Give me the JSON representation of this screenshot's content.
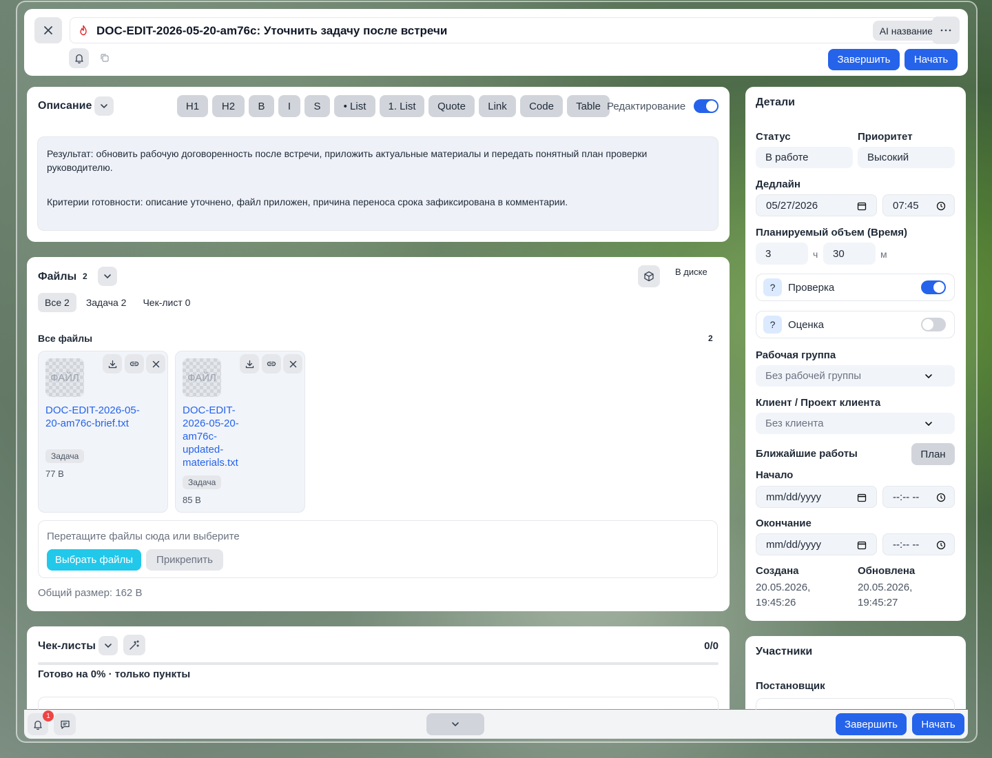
{
  "header": {
    "task_title": "DOC-EDIT-2026-05-20-am76c: Уточнить задачу после встречи",
    "ai_name_label": "AI название",
    "finish_label": "Завершить",
    "start_label": "Начать"
  },
  "description": {
    "title": "Описание",
    "toolbar": [
      "H1",
      "H2",
      "B",
      "I",
      "S",
      "• List",
      "1. List",
      "Quote",
      "Link",
      "Code",
      "Table"
    ],
    "edit_label": "Редактирование",
    "paragraph1": "Результат: обновить рабочую договоренность после встречи, приложить актуальные материалы и передать понятный план проверки руководителю.",
    "paragraph2": "Критерии готовности: описание уточнено, файл приложен, причина переноса срока зафиксирована в комментарии."
  },
  "files": {
    "title": "Файлы",
    "count": "2",
    "disk_label": "В диске",
    "tabs": [
      "Все 2",
      "Задача 2",
      "Чек-лист 0"
    ],
    "section_title": "Все файлы",
    "section_count": "2",
    "items": [
      {
        "thumb": "ФАЙЛ",
        "name": "DOC-EDIT-2026-05-20-am76c-brief.txt",
        "tag": "Задача",
        "size": "77 B"
      },
      {
        "thumb": "ФАЙЛ",
        "name": "DOC-EDIT-2026-05-20-am76c-updated-materials.txt",
        "tag": "Задача",
        "size": "85 B"
      }
    ],
    "drop_hint": "Перетащите файлы сюда или выберите",
    "choose_label": "Выбрать файлы",
    "attach_label": "Прикрепить",
    "total_size": "Общий размер: 162 B"
  },
  "checklists": {
    "title": "Чек-листы",
    "counter": "0/0",
    "progress": 0,
    "status": "Готово на 0% · только пункты"
  },
  "details": {
    "title": "Детали",
    "status_label": "Статус",
    "status_value": "В работе",
    "priority_label": "Приоритет",
    "priority_value": "Высокий",
    "deadline_label": "Дедлайн",
    "deadline_date": "05/27/2026",
    "deadline_time": "07:45",
    "volume_label": "Планируемый объем (Время)",
    "hours": "3",
    "hours_unit": "ч",
    "minutes": "30",
    "minutes_unit": "м",
    "check_label": "Проверка",
    "check_on": true,
    "rating_label": "Оценка",
    "rating_on": false,
    "help_mark": "?",
    "group_label": "Рабочая группа",
    "group_value": "Без рабочей группы",
    "client_label": "Клиент / Проект клиента",
    "client_value": "Без клиента",
    "nearest_label": "Ближайшие работы",
    "plan_label": "План",
    "start_label": "Начало",
    "start_date": "mm/dd/yyyy",
    "start_time": "--:-- --",
    "end_label": "Окончание",
    "end_date": "mm/dd/yyyy",
    "end_time": "--:-- --",
    "created_label": "Создана",
    "created_value": "20.05.2026, 19:45:26",
    "updated_label": "Обновлена",
    "updated_value": "20.05.2026, 19:45:27"
  },
  "participants": {
    "title": "Участники",
    "author_label": "Постановщик"
  },
  "bottom_bar": {
    "notification_count": "1",
    "finish_label": "Завершить",
    "start_label": "Начать"
  },
  "colors": {
    "accent": "#2563eb",
    "cyan": "#22c8ea",
    "badge": "#ef4444",
    "fire": "#dc2626"
  }
}
